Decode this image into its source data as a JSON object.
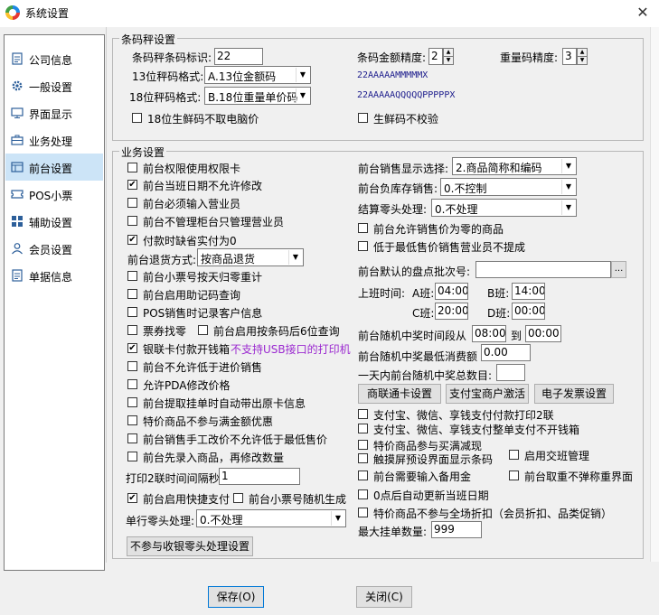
{
  "window": {
    "title": "系统设置"
  },
  "sidebar": {
    "items": [
      {
        "label": "公司信息",
        "icon": "document-icon"
      },
      {
        "label": "一般设置",
        "icon": "gear-icon"
      },
      {
        "label": "界面显示",
        "icon": "monitor-icon"
      },
      {
        "label": "业务处理",
        "icon": "briefcase-icon"
      },
      {
        "label": "前台设置",
        "icon": "window-icon",
        "selected": true
      },
      {
        "label": "POS小票",
        "icon": "ticket-icon"
      },
      {
        "label": "辅助设置",
        "icon": "grid-icon"
      },
      {
        "label": "会员设置",
        "icon": "user-icon"
      },
      {
        "label": "单据信息",
        "icon": "document-icon"
      }
    ]
  },
  "barcode": {
    "legend": "条码秤设置",
    "id_label": "条码秤条码标识:",
    "id_value": "22",
    "amount_precision_label": "条码金额精度:",
    "amount_precision_value": "2",
    "weight_precision_label": "重量码精度:",
    "weight_precision_value": "3",
    "fmt13_label": "13位秤码格式:",
    "fmt13_value": "A.13位金额码",
    "fmt13_pattern": "22AAAAAMMMMMX",
    "fmt18_label": "18位秤码格式:",
    "fmt18_value": "B.18位重量单价码",
    "fmt18_pattern": "22AAAAAQQQQQPPPPPX",
    "chk_18_no_price": "18位生鲜码不取电脑价",
    "chk_fresh_no_verify": "生鲜码不校验"
  },
  "business": {
    "legend": "业务设置",
    "left": {
      "chk_perm_card": "前台权限使用权限卡",
      "chk_no_date_modify": "前台当班日期不允许修改",
      "chk_input_salesman": "前台必须输入营业员",
      "chk_counter_salesman": "前台不管理柜台只管理营业员",
      "chk_default_actual_zero": "付款时缺省实付为0",
      "return_mode_label": "前台退货方式:",
      "return_mode_value": "按商品退货",
      "chk_ticket_daily_reset": "前台小票号按天归零重计",
      "chk_mnemonic_query": "前台启用助记码查询",
      "chk_pos_customer_info": "POS销售时记录客户信息",
      "chk_voucher_change": "票券找零",
      "chk_barcode_last6": "前台启用按条码后6位查询",
      "chk_unionpay_drawer": "银联卡付款开钱箱",
      "unionpay_note": "不支持USB接口的打印机",
      "chk_no_below_cost": "前台不允许低于进价销售",
      "chk_pda_price": "允许PDA修改价格",
      "chk_pick_original_card": "前台提取挂单时自动带出原卡信息",
      "chk_special_no_promo": "特价商品不参与满金额优惠",
      "chk_manual_price_min": "前台销售手工改价不允许低于最低售价",
      "chk_input_then_qty": "前台先录入商品，再修改数量",
      "print2_label": "打印2联时间间隔秒",
      "print2_value": "1",
      "chk_quick_pay": "前台启用快捷支付",
      "chk_random_ticket": "前台小票号随机生成",
      "single_zero_label": "单行零头处理:",
      "single_zero_value": "0.不处理",
      "btn_no_cashier_zero": "不参与收银零头处理设置"
    },
    "right": {
      "display_sel_label": "前台销售显示选择:",
      "display_sel_value": "2.商品简称和编码",
      "neg_stock_label": "前台负库存销售:",
      "neg_stock_value": "0.不控制",
      "settle_zero_label": "结算零头处理:",
      "settle_zero_value": "0.不处理",
      "chk_zero_price": "前台允许销售价为零的商品",
      "chk_below_min_no_commission": "低于最低售价销售营业员不提成",
      "stocktake_label": "前台默认的盘点批次号:",
      "stocktake_value": "",
      "stocktake_btn": "...",
      "shift_label": "上班时间:",
      "shift_a_label": "A班:",
      "shift_a_value": "04:00",
      "shift_b_label": "B班:",
      "shift_b_value": "14:00",
      "shift_c_label": "C班:",
      "shift_c_value": "20:00",
      "shift_d_label": "D班:",
      "shift_d_value": "00:00",
      "lottery_period_label": "前台随机中奖时间段从",
      "lottery_from": "08:00",
      "lottery_to_label": "到",
      "lottery_to": "00:00",
      "lottery_min_label": "前台随机中奖最低消费额",
      "lottery_min_value": "0.00",
      "lottery_count_label": "一天内前台随机中奖总数目:",
      "lottery_count_value": "",
      "btn_shanglian": "商联通卡设置",
      "btn_alipay": "支付宝商户激活",
      "btn_einvoice": "电子发票设置",
      "chk_pay_print2": "支付宝、微信、享钱支付付款打印2联",
      "chk_pay_no_drawer": "支付宝、微信、享钱支付整单支付不开钱箱",
      "chk_special_buy_cut": "特价商品参与买满减现",
      "chk_shift_manage": "启用交班管理",
      "chk_touch_barcode": "触摸屏预设界面显示条码",
      "chk_backup_price": "前台需要输入备用金",
      "chk_no_scale_popup": "前台取重不弹称重界面",
      "chk_midnight_update": "0点后自动更新当班日期",
      "chk_special_no_discount": "特价商品不参与全场折扣（会员折扣、品类促销）",
      "max_hang_label": "最大挂单数量:",
      "max_hang_value": "999"
    }
  },
  "footer": {
    "save": "保存(O)",
    "close": "关闭(C)"
  }
}
